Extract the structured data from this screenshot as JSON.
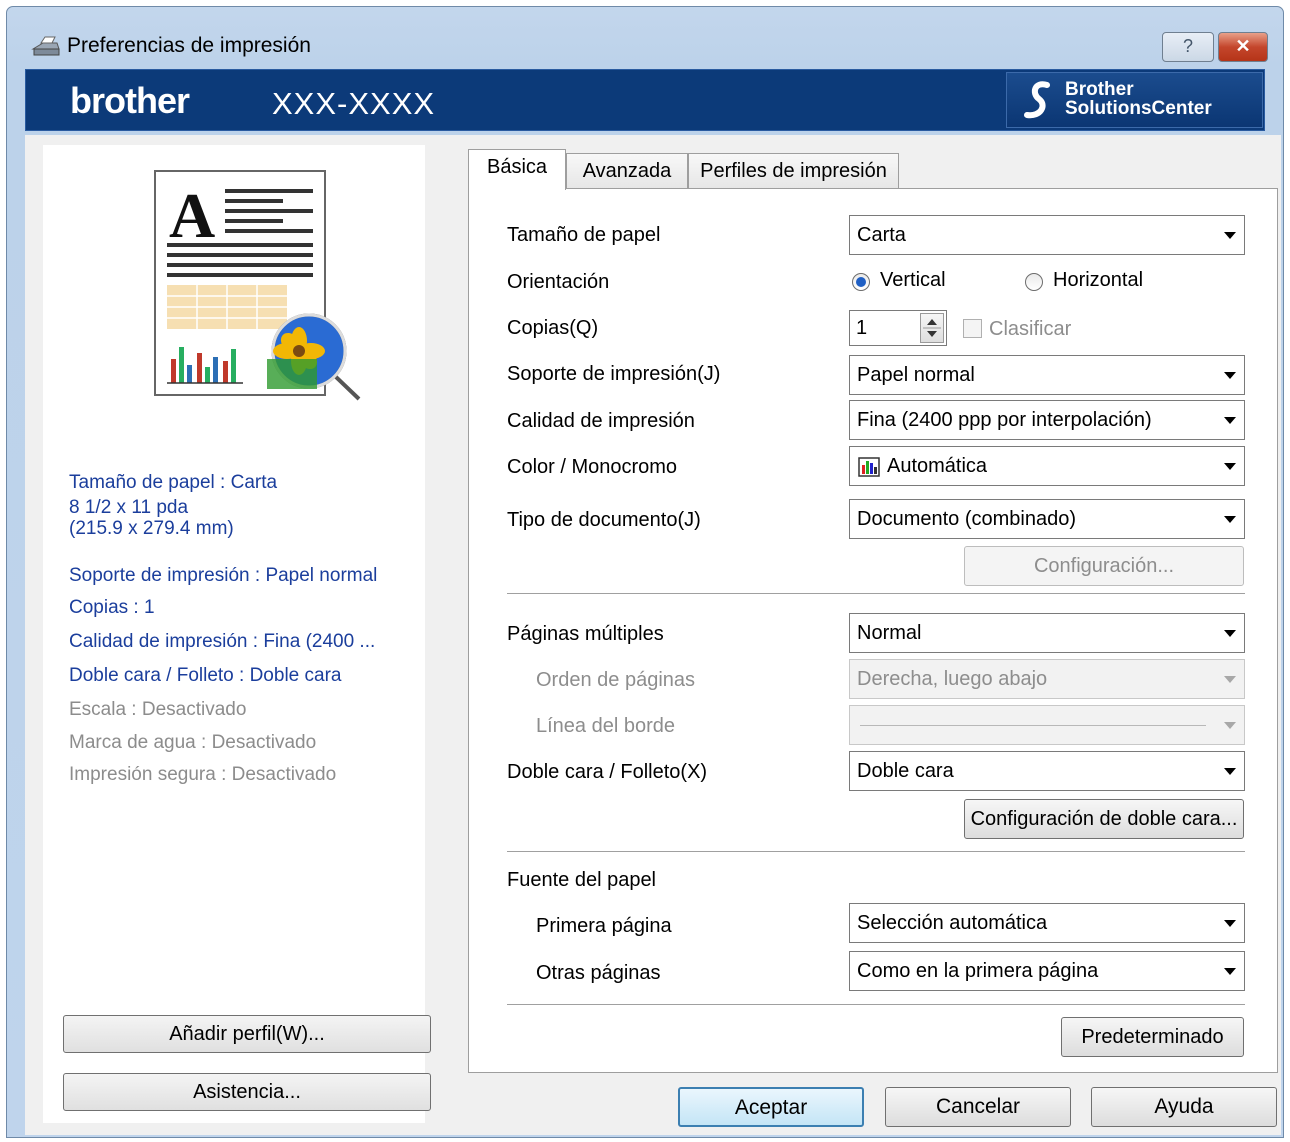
{
  "window": {
    "title": "Preferencias de impresión",
    "help_button": "?",
    "close_button": "✕"
  },
  "header": {
    "brand": "brother",
    "model": "XXX-XXXX",
    "solutions_line1": "Brother",
    "solutions_line2": "SolutionsCenter"
  },
  "summary": {
    "paper_size": "Tamaño de papel : Carta",
    "paper_dims_1": "8 1/2 x 11 pda",
    "paper_dims_2": "(215.9 x 279.4 mm)",
    "media": "Soporte de impresión : Papel normal",
    "copies": "Copias : 1",
    "quality": "Calidad de impresión : Fina (2400 ...",
    "duplex": "Doble cara / Folleto : Doble cara",
    "scale": "Escala : Desactivado",
    "watermark": "Marca de agua : Desactivado",
    "secure": "Impresión segura : Desactivado"
  },
  "left_buttons": {
    "add_profile": "Añadir perfil(W)...",
    "support": "Asistencia..."
  },
  "tabs": [
    "Básica",
    "Avanzada",
    "Perfiles de impresión"
  ],
  "basic": {
    "paper_size_label": "Tamaño de papel",
    "paper_size_value": "Carta",
    "orientation_label": "Orientación",
    "orientation_vertical": "Vertical",
    "orientation_horizontal": "Horizontal",
    "copies_label": "Copias(Q)",
    "copies_value": "1",
    "collate_label": "Clasificar",
    "media_label": "Soporte de impresión(J)",
    "media_value": "Papel normal",
    "quality_label": "Calidad de impresión",
    "quality_value": "Fina (2400 ppp por interpolación)",
    "color_label": "Color / Monocromo",
    "color_value": "Automática",
    "doctype_label": "Tipo de documento(J)",
    "doctype_value": "Documento (combinado)",
    "settings_button": "Configuración...",
    "multipage_label": "Páginas múltiples",
    "multipage_value": "Normal",
    "page_order_label": "Orden de páginas",
    "page_order_value": "Derecha, luego abajo",
    "border_label": "Línea del borde",
    "duplex_label": "Doble cara / Folleto(X)",
    "duplex_value": "Doble cara",
    "duplex_settings_button": "Configuración de doble cara...",
    "paper_source_label": "Fuente del papel",
    "first_page_label": "Primera página",
    "first_page_value": "Selección automática",
    "other_pages_label": "Otras páginas",
    "other_pages_value": "Como en la primera página",
    "default_button": "Predeterminado"
  },
  "footer": {
    "ok": "Aceptar",
    "cancel": "Cancelar",
    "help": "Ayuda"
  },
  "colors": {
    "header_bg": "#0c3a79",
    "summary_text": "#1b3e9c",
    "disabled_text": "#8d8d8d"
  }
}
